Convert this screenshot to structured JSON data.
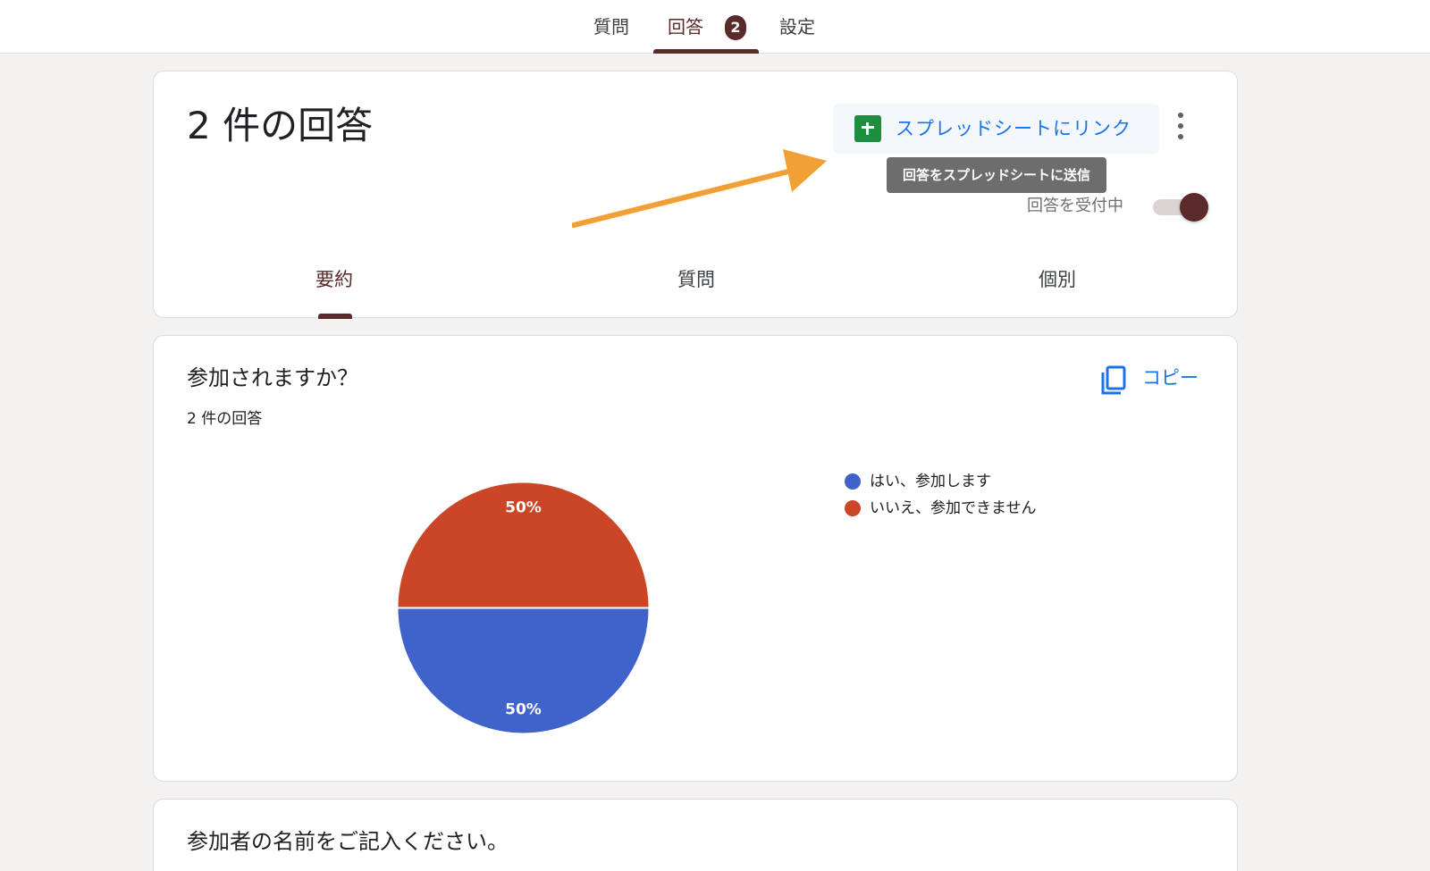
{
  "top_nav": {
    "tabs": [
      {
        "label": "質問"
      },
      {
        "label": "回答",
        "badge": "2"
      },
      {
        "label": "設定"
      }
    ],
    "active_tab": "回答"
  },
  "summary_card": {
    "title": "2 件の回答",
    "sheet_button_label": "スプレッドシートにリンク",
    "tooltip": "回答をスプレッドシートに送信",
    "accepting_label": "回答を受付中",
    "accepting_on": true,
    "subtabs": [
      {
        "label": "要約"
      },
      {
        "label": "質問"
      },
      {
        "label": "個別"
      }
    ],
    "active_subtab": "要約"
  },
  "question_card": {
    "title": "参加されますか？",
    "response_count": "2 件の回答",
    "copy_label": "コピー"
  },
  "next_question": {
    "title": "参加者の名前をご記入ください。"
  },
  "colors": {
    "accent": "#5b2a2a",
    "link_blue": "#1a73e8",
    "sheets_green": "#1e8e3e",
    "annotation_arrow": "#f0a035"
  },
  "icons": {
    "sheets": "sheets-icon",
    "more": "more-vert-icon",
    "copy": "copy-icon",
    "annotation": "arrow-annotation"
  },
  "chart_data": {
    "type": "pie",
    "series": [
      {
        "label": "はい、参加します",
        "value": 50,
        "display": "50%",
        "color": "#3f63c8"
      },
      {
        "label": "いいえ、参加できません",
        "value": 50,
        "display": "50%",
        "color": "#cb4626"
      }
    ],
    "legend_position": "right"
  }
}
